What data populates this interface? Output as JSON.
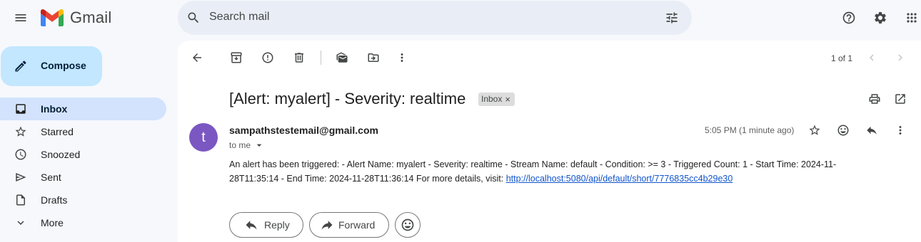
{
  "app": {
    "name": "Gmail"
  },
  "search": {
    "placeholder": "Search mail"
  },
  "compose": {
    "label": "Compose"
  },
  "sidebar": {
    "items": [
      {
        "label": "Inbox",
        "icon": "inbox-icon",
        "active": true
      },
      {
        "label": "Starred",
        "icon": "star-icon"
      },
      {
        "label": "Snoozed",
        "icon": "clock-icon"
      },
      {
        "label": "Sent",
        "icon": "send-icon"
      },
      {
        "label": "Drafts",
        "icon": "draft-icon"
      },
      {
        "label": "More",
        "icon": "chevron-down-icon"
      }
    ]
  },
  "toolbar": {
    "pager": "1 of 1"
  },
  "email": {
    "subject": "[Alert: myalert] - Severity: realtime",
    "label_chip": "Inbox",
    "chip_close": "×",
    "sender_initial": "t",
    "sender": "sampathstestemail@gmail.com",
    "recipient": "to me",
    "time": "5:05 PM (1 minute ago)",
    "body": "An alert has been triggered: - Alert Name: myalert - Severity: realtime - Stream Name: default - Condition: >= 3 - Triggered Count: 1 - Start Time: 2024-11-28T11:35:14 - End Time: 2024-11-28T11:36:14 For more details, visit:",
    "link": "http://localhost:5080/api/default/short/7776835cc4b29e30"
  },
  "actions": {
    "reply": "Reply",
    "forward": "Forward"
  },
  "colors": {
    "accent": "#c2e7ff",
    "active_nav": "#d3e3fd",
    "avatar": "#7b57c2",
    "link": "#1155cc"
  }
}
